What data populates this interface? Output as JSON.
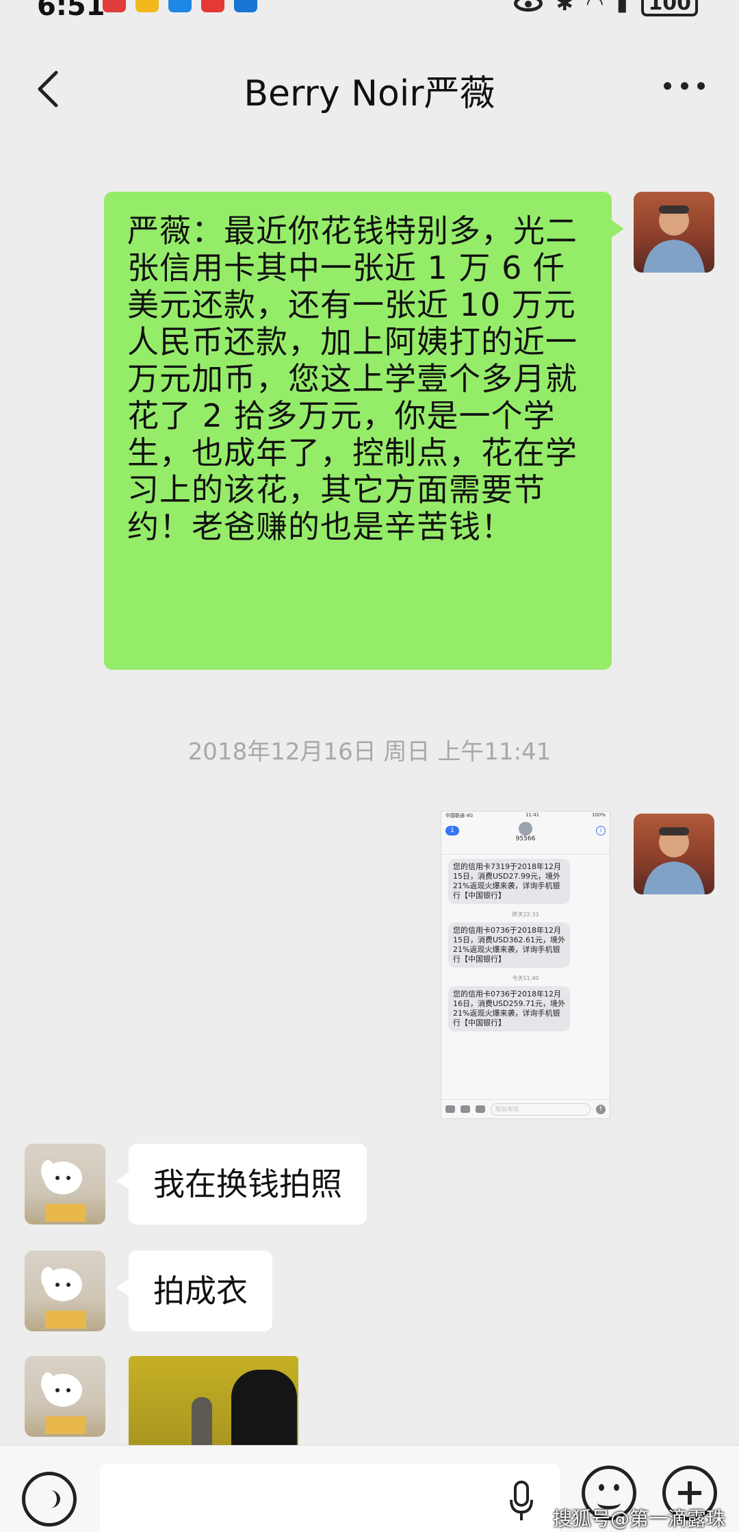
{
  "status_bar": {
    "time": "6:51",
    "battery": "100"
  },
  "header": {
    "title": "Berry Noir严薇"
  },
  "messages": {
    "dad_text": "严薇：最近你花钱特别多，光二张信用卡其中一张近 1 万 6 仟美元还款，还有一张近 10 万元人民币还款，加上阿姨打的近一万元加币，您这上学壹个多月就花了 2 拾多万元，你是一个学生，也成年了，控制点，花在学习上的该花，其它方面需要节约！老爸赚的也是辛苦钱！",
    "timestamp": "2018年12月16日 周日 上午11:41",
    "reply_1": "我在换钱拍照",
    "reply_2": "拍成衣"
  },
  "sms_screenshot": {
    "carrier": "中国联通 4G",
    "time": "11:41",
    "battery": "100%",
    "back_badge": "1",
    "contact": "95566",
    "messages": [
      "您的信用卡7319于2018年12月15日，消费USD27.99元，境外21%返现火爆来袭，详询手机银行【中国银行】",
      "您的信用卡0736于2018年12月15日，消费USD362.61元，境外21%返现火爆来袭，详询手机银行【中国银行】",
      "您的信用卡0736于2018年12月16日，消费USD259.71元，境外21%返现火爆来袭，详询手机银行【中国银行】"
    ],
    "time_labels": [
      "昨天22:33",
      "今天11:40"
    ],
    "input_placeholder": "短信/彩信"
  },
  "watermark": "搜狐号@第一滴露珠",
  "colors": {
    "background": "#ededed",
    "sent_bubble": "#95ec69",
    "received_bubble": "#ffffff"
  }
}
